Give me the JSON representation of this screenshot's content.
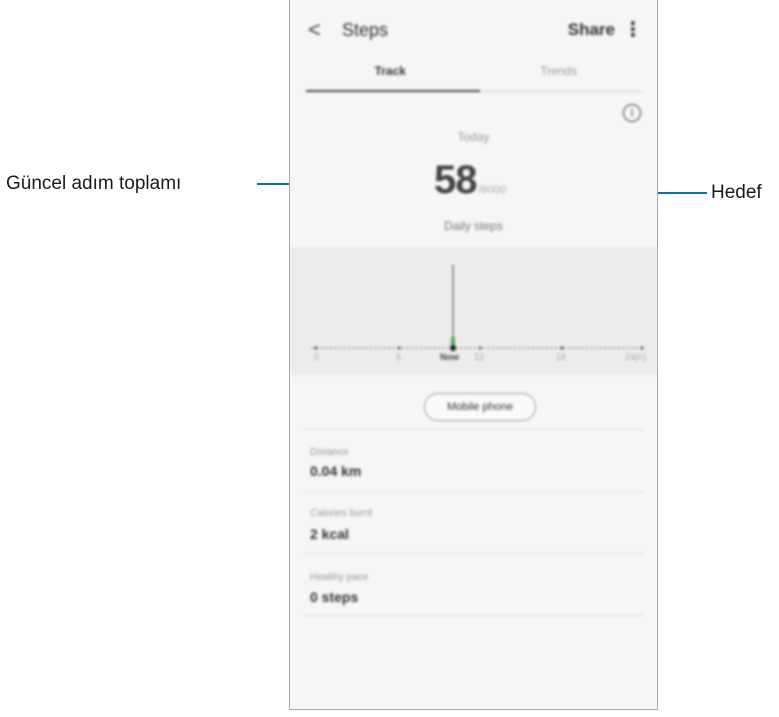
{
  "app": {
    "title": "Steps",
    "share_label": "Share",
    "back_glyph": "<",
    "more_glyph": "⋮",
    "info_glyph": "i"
  },
  "tabs": [
    {
      "label": "Track",
      "active": true
    },
    {
      "label": "Trends",
      "active": false
    }
  ],
  "summary": {
    "today_label": "Today",
    "current_steps": "58",
    "goal": "/6000",
    "daily_steps_label": "Daily steps"
  },
  "chart": {
    "x_labels": [
      "0",
      "6",
      "Now",
      "12",
      "18",
      "24(h)"
    ],
    "colors": {
      "bar": "#4caf50",
      "dots": "#555555",
      "marker": "#222222"
    }
  },
  "source_button": "Mobile phone",
  "stats": [
    {
      "label": "Distance",
      "value": "0.04 km"
    },
    {
      "label": "Calories burnt",
      "value": "2 kcal"
    },
    {
      "label": "Healthy pace",
      "value": "0 steps"
    }
  ],
  "callouts": {
    "left": "Güncel adım toplamı",
    "right": "Hedef",
    "line_color": "#0b6fb0"
  }
}
